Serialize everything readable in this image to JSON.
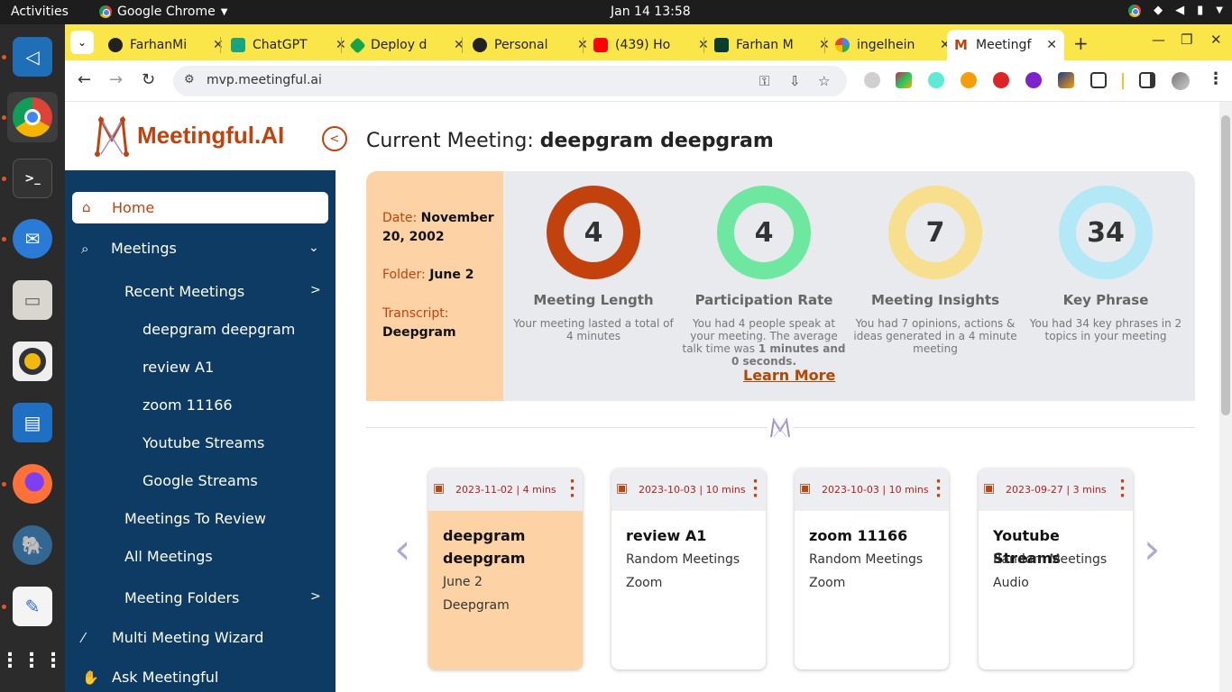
{
  "os": {
    "activities": "Activities",
    "app_name": "Google Chrome",
    "clock": "Jan 14  13:58"
  },
  "dock": {
    "apps": [
      "vscode-icon",
      "chrome-icon",
      "terminal-icon",
      "thunderbird-icon",
      "files-icon",
      "rhythmbox-icon",
      "writer-icon",
      "firefox-icon",
      "pgadmin-icon",
      "text-editor-icon",
      "app-grid-icon"
    ]
  },
  "browser": {
    "tabs": [
      {
        "title": "FarhanMi",
        "icon": "github-icon"
      },
      {
        "title": "ChatGPT",
        "icon": "chatgpt-icon"
      },
      {
        "title": "Deploy d",
        "icon": "deploy-icon"
      },
      {
        "title": "Personal",
        "icon": "github-icon"
      },
      {
        "title": "(439) Ho",
        "icon": "youtube-icon"
      },
      {
        "title": "Farhan M",
        "icon": "upwork-icon"
      },
      {
        "title": "ingelhein",
        "icon": "google-icon"
      },
      {
        "title": "Meetingf",
        "icon": "meetingful-icon"
      }
    ],
    "url": "mvp.meetingful.ai"
  },
  "brand": {
    "name": "Meetingful.AI",
    "accent": "#c2410c",
    "sidebar_bg": "#0d3b63"
  },
  "sidebar": {
    "home": "Home",
    "meetings": "Meetings",
    "recent_meetings": "Recent Meetings",
    "recent": [
      "deepgram deepgram",
      "review A1",
      "zoom 11166",
      "Youtube Streams",
      "Google Streams"
    ],
    "to_review": "Meetings To Review",
    "all_meetings": "All Meetings",
    "folders": "Meeting Folders",
    "wizard": "Multi Meeting Wizard",
    "ask": "Ask Meetingful"
  },
  "main": {
    "title_prefix": "Current Meeting:",
    "title_name": "deepgram deepgram",
    "date_label": "Date:",
    "date_value": "November 20, 2002",
    "folder_label": "Folder:",
    "folder_value": "June 2",
    "transcript_label": "Transcript:",
    "transcript_value": "Deepgram",
    "stats": [
      {
        "value": "4",
        "label": "Meeting Length",
        "desc": "Your meeting lasted a total of 4 minutes",
        "color": "#c2410c"
      },
      {
        "value": "4",
        "label": "Participation Rate",
        "desc_a": "You had 4 people speak at your meeting. The average talk time was ",
        "desc_b": "1 minutes and 0 seconds.",
        "color": "#6ee7a0"
      },
      {
        "value": "7",
        "label": "Meeting Insights",
        "desc": "You had 7 opinions, actions & ideas generated in a 4 minute meeting",
        "color": "#f7df8e"
      },
      {
        "value": "34",
        "label": "Key Phrase",
        "desc": "You had 34 key phrases in 2 topics in your meeting",
        "color": "#b3e8f7"
      }
    ],
    "learn_more": "Learn More",
    "cards": [
      {
        "date": "2023-11-02 | 4 mins",
        "title": "deepgram deepgram",
        "line1": "June 2",
        "line2": "Deepgram"
      },
      {
        "date": "2023-10-03 | 10 mins",
        "title": "review A1",
        "line1": "Random Meetings",
        "line2": "Zoom"
      },
      {
        "date": "2023-10-03 | 10 mins",
        "title": "zoom 11166",
        "line1": "Random Meetings",
        "line2": "Zoom"
      },
      {
        "date": "2023-09-27 | 3 mins",
        "title": "Youtube Streams",
        "line1": "Random Meetings",
        "line2": "Audio"
      }
    ]
  }
}
